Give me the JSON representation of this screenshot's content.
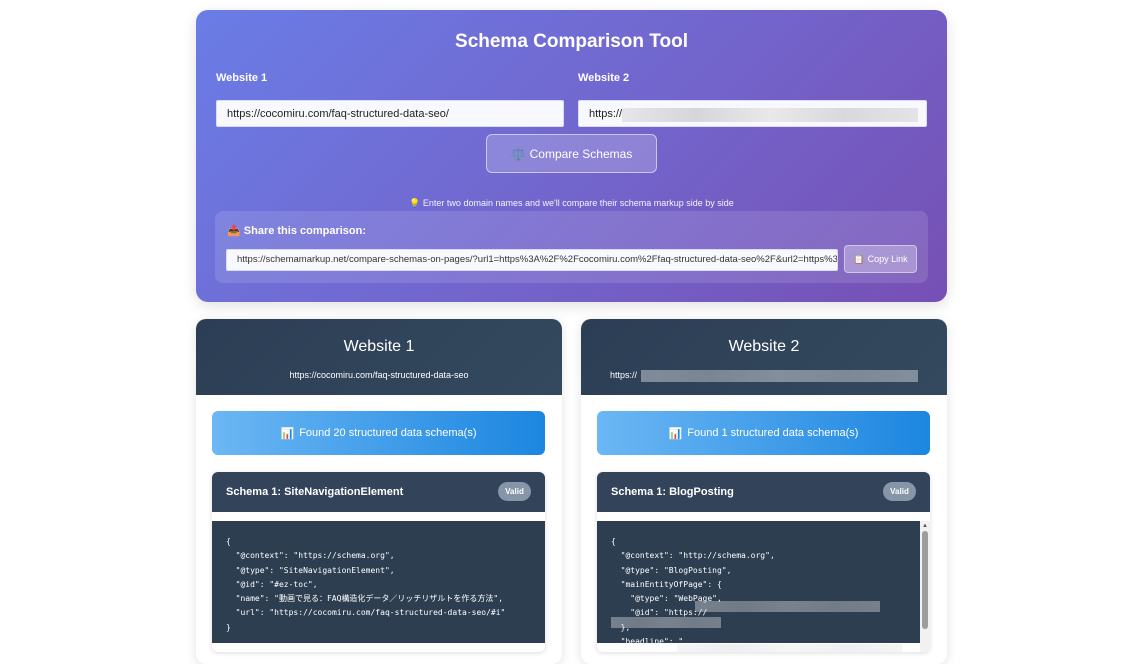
{
  "hero": {
    "title": "Schema Comparison Tool",
    "site1_label": "Website 1",
    "site1_value": "https://cocomiru.com/faq-structured-data-seo/",
    "site2_label": "Website 2",
    "site2_value": "https://",
    "compare_icon": "⚖️",
    "compare_label": "Compare Schemas",
    "hint_icon": "💡",
    "hint": "Enter two domain names and we'll compare their schema markup side by side"
  },
  "share": {
    "icon": "📤",
    "label": "Share this comparison:",
    "link": "https://schemamarkup.net/compare-schemas-on-pages/?url1=https%3A%2F%2Fcocomiru.com%2Ffaq-structured-data-seo%2F&url2=https%3A%",
    "copy_icon": "📋",
    "copy_label": "Copy Link"
  },
  "panels": [
    {
      "title": "Website 1",
      "url": "https://cocomiru.com/faq-structured-data-seo",
      "found_icon": "📊",
      "found": "Found 20 structured data schema(s)",
      "schema_title": "Schema 1: SiteNavigationElement",
      "badge": "Valid",
      "code": [
        "{",
        "  \"@context\": \"https://schema.org\",",
        "  \"@type\": \"SiteNavigationElement\",",
        "  \"@id\": \"#ez-toc\",",
        "  \"name\": \"動画で見る：FAQ構造化データ／リッチリザルトを作る方法\",",
        "  \"url\": \"https://cocomiru.com/faq-structured-data-seo/#i\"",
        "}"
      ]
    },
    {
      "title": "Website 2",
      "url": "https://",
      "found_icon": "📊",
      "found": "Found 1 structured data schema(s)",
      "schema_title": "Schema 1: BlogPosting",
      "badge": "Valid",
      "code": [
        "{",
        "  \"@context\": \"http://schema.org\",",
        "  \"@type\": \"BlogPosting\",",
        "  \"mainEntityOfPage\": {",
        "    \"@type\": \"WebPage\",",
        "    \"@id\": \"https://",
        "",
        "  },",
        "  \"headline\": \""
      ]
    }
  ],
  "colors": {
    "hero_start": "#6a7de6",
    "hero_end": "#7650b4",
    "panel_header": "#2c3e55",
    "found_start": "#6cb7f4",
    "found_end": "#1c86e0",
    "code_bg": "#2c3e50"
  }
}
